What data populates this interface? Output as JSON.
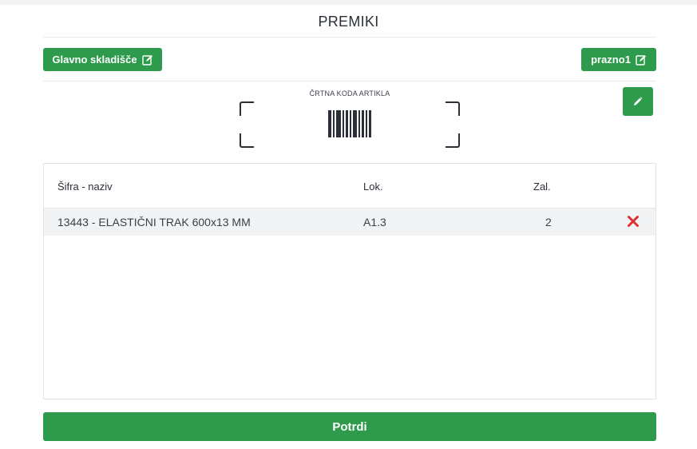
{
  "page": {
    "title": "PREMIKI"
  },
  "source_warehouse": {
    "label": "Glavno skladišče",
    "icon": "edit-icon"
  },
  "target_warehouse": {
    "label": "prazno1",
    "icon": "edit-icon"
  },
  "scanner": {
    "label": "ČRTNA KODA ARTIKLA",
    "icon": "barcode-icon",
    "edit_icon": "pencil-icon"
  },
  "table": {
    "headers": {
      "code_name": "Šifra - naziv",
      "location": "Lok.",
      "stock": "Zal."
    },
    "rows": [
      {
        "code_name": "13443 - ELASTIČNI TRAK 600x13 MM",
        "location": "A1.3",
        "stock": "2",
        "delete_icon": "close-icon"
      }
    ]
  },
  "confirm": {
    "label": "Potrdi"
  },
  "colors": {
    "accent": "#2e9a4b",
    "delete": "#e03131",
    "row_bg": "#f2f3f5"
  }
}
